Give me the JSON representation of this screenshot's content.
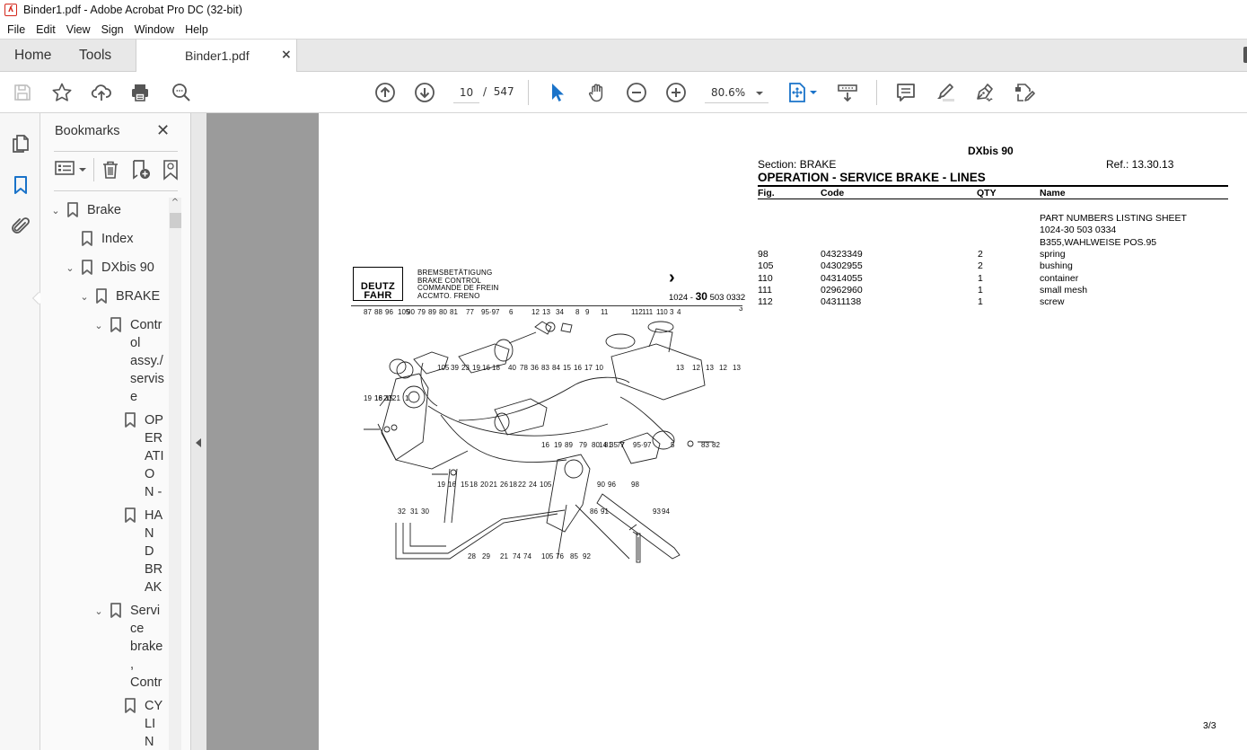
{
  "window": {
    "title": "Binder1.pdf - Adobe Acrobat Pro DC (32-bit)",
    "app_icon": "acrobat-icon"
  },
  "menubar": {
    "items": [
      "File",
      "Edit",
      "View",
      "Sign",
      "Window",
      "Help"
    ]
  },
  "tabs": {
    "home": "Home",
    "tools": "Tools",
    "document": "Binder1.pdf",
    "close_symbol": "×"
  },
  "toolbar": {
    "left_icons": [
      "save-icon",
      "bookmark-star-icon",
      "upload-cloud-icon",
      "print-icon",
      "search-zoom-icon"
    ],
    "page_current": "10",
    "page_separator": "/",
    "page_total": "547",
    "zoom_level": "80.6%",
    "tool_icons": [
      "prev-page-icon",
      "next-page-icon",
      "select-cursor-icon",
      "hand-icon",
      "zoom-out-icon",
      "zoom-in-icon",
      "fit-page-icon",
      "scroll-mode-icon",
      "comment-icon",
      "highlight-icon",
      "sign-icon",
      "edit-pdf-icon"
    ]
  },
  "left_rail": {
    "icons": [
      "page-thumbnails-icon",
      "bookmarks-icon",
      "attachments-icon"
    ],
    "active": "bookmarks-icon"
  },
  "bookmarks": {
    "title": "Bookmarks",
    "close_symbol": "✕",
    "tools": [
      "options-icon",
      "delete-bookmark-icon",
      "add-bookmark-icon",
      "tagged-bookmark-icon"
    ],
    "tree": [
      {
        "label": "Brake",
        "level": 0,
        "expanded": true
      },
      {
        "label": "Index",
        "level": 1,
        "expanded": null
      },
      {
        "label": "DXbis 90",
        "level": 1,
        "expanded": true
      },
      {
        "label": "BRAKE",
        "level": 2,
        "expanded": true
      },
      {
        "label": "Control assy./servise",
        "level": 3,
        "expanded": true
      },
      {
        "label": "OPERATION -",
        "level": 4,
        "expanded": null
      },
      {
        "label": "HAND BRAK",
        "level": 4,
        "expanded": null
      },
      {
        "label": "Service brake, Contr",
        "level": 3,
        "expanded": true
      },
      {
        "label": "CYLIN",
        "level": 4,
        "expanded": null
      }
    ],
    "tree_display": [
      "Brake",
      "Index",
      "DXbis 90",
      "BRAKE",
      "Contr\nol\nassy./\nservis\ne",
      "OP\nER\nATI\nO\nN -",
      "HA\nN\nD\nBR\nAK",
      "Servi\nce\nbrake\n,\nContr",
      "CY\nLI\nN"
    ]
  },
  "document": {
    "model": "DXbis 90",
    "section": "Section: BRAKE",
    "ref": "Ref.: 13.30.13",
    "title": "OPERATION - SERVICE BRAKE - LINES",
    "columns": [
      "Fig.",
      "Code",
      "QTY",
      "Name"
    ],
    "notes": [
      "PART NUMBERS LISTING SHEET",
      "1024-30 503 0334",
      "B355,WAHLWEISE POS.95"
    ],
    "rows": [
      {
        "fig": "98",
        "code": "04323349",
        "qty": "2",
        "name": "spring"
      },
      {
        "fig": "105",
        "code": "04302955",
        "qty": "2",
        "name": "bushing"
      },
      {
        "fig": "110",
        "code": "04314055",
        "qty": "1",
        "name": "container"
      },
      {
        "fig": "111",
        "code": "02962960",
        "qty": "1",
        "name": "small mesh"
      },
      {
        "fig": "112",
        "code": "04311138",
        "qty": "1",
        "name": "screw"
      }
    ],
    "page_number": "3/3",
    "diagram": {
      "logo": [
        "DEUTZ",
        "FAHR"
      ],
      "heading_lines": [
        "BREMSBETÄTIGUNG",
        "BRAKE CONTROL",
        "COMMANDE DE FREIN",
        "ACCMTO. FRENO"
      ],
      "drawing_prefix": "1024 - ",
      "drawing_bold": "30",
      "drawing_suffix": " 503 0332",
      "sheet_mark": "3",
      "top_callouts": [
        "87",
        "88",
        "96",
        "105",
        "90",
        "79",
        "89",
        "80",
        "81",
        "77",
        "95·97",
        "6",
        "12",
        "13",
        "34",
        "8",
        "9",
        "11",
        "112",
        "111",
        "110",
        "3",
        "4"
      ],
      "mid_callouts": [
        "105",
        "39",
        "23",
        "19",
        "16",
        "18",
        "40",
        "78",
        "36",
        "83",
        "84",
        "15",
        "16",
        "17",
        "10",
        "13",
        "12",
        "13",
        "12",
        "13"
      ],
      "left_callouts": [
        "18",
        "20",
        "21",
        "19",
        "16",
        "15",
        "1"
      ],
      "row3_callouts": [
        "14",
        "35",
        "7",
        "16",
        "19",
        "89",
        "79",
        "80",
        "81",
        "77",
        "95·97",
        "5",
        "83",
        "82"
      ],
      "row4_callouts": [
        "19",
        "16",
        "15",
        "18",
        "20",
        "21",
        "26",
        "18",
        "22",
        "24",
        "105",
        "90",
        "96",
        "98"
      ],
      "bottom_callouts": [
        "32",
        "31",
        "30",
        "86",
        "91",
        "93",
        "94",
        "28",
        "29",
        "74",
        "21",
        "74",
        "105",
        "76",
        "85",
        "92"
      ]
    }
  }
}
